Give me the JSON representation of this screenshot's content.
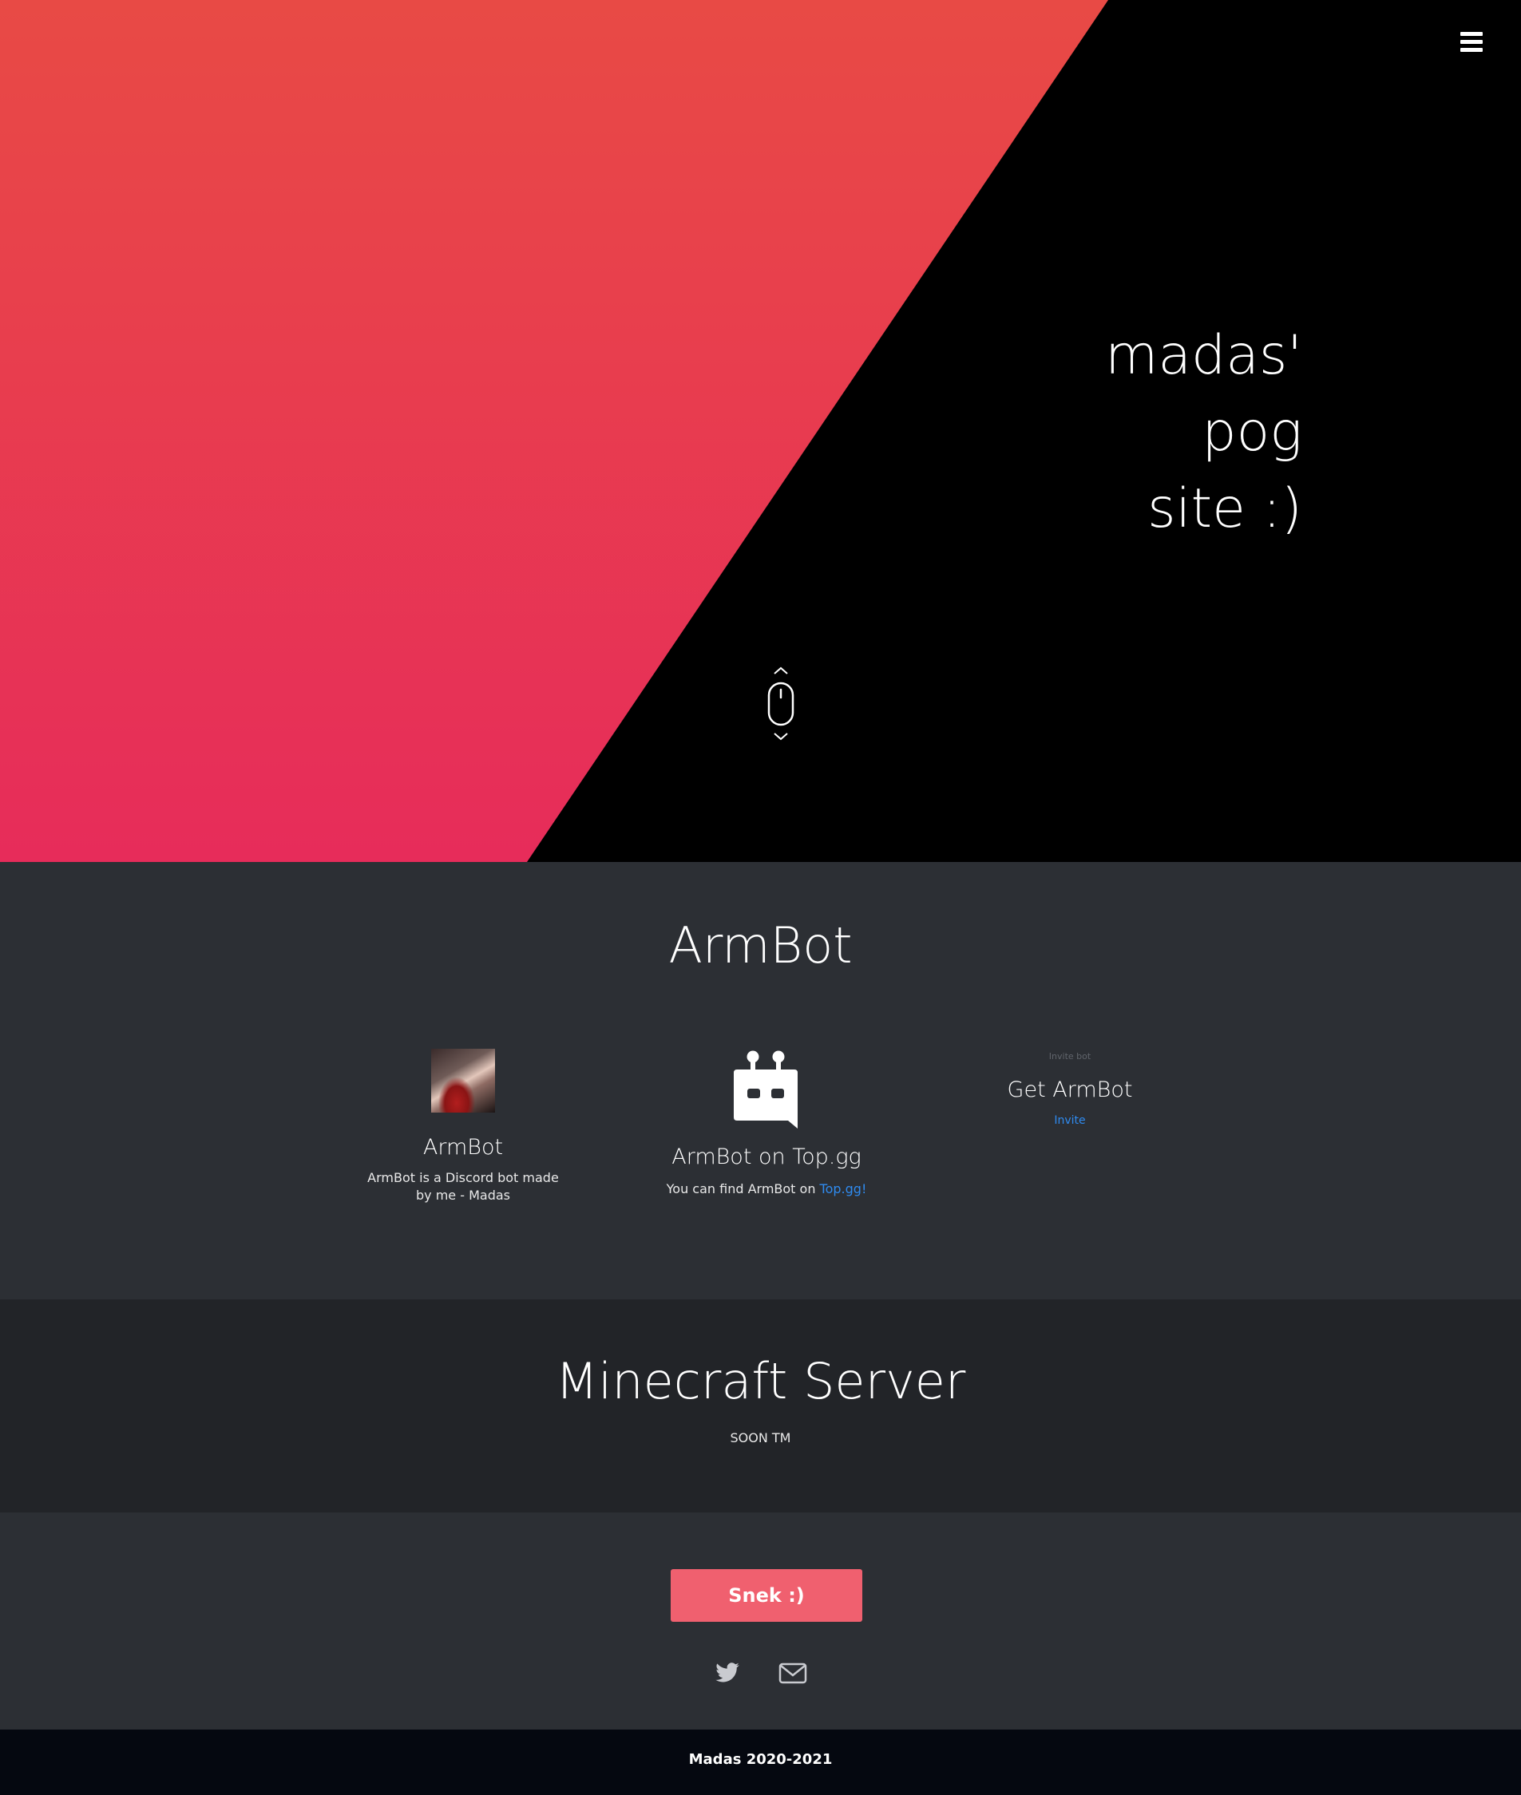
{
  "hero": {
    "title_lines": [
      "madas'",
      "pog",
      "site :)"
    ],
    "colors": {
      "gradient_top": "#e84a45",
      "gradient_bottom": "#e72c5a",
      "dark": "#000000"
    },
    "menu_icon": "hamburger-menu-icon",
    "scroll_icon": "mouse-scroll-icon"
  },
  "armbot": {
    "title": "ArmBot",
    "cards": [
      {
        "title": "ArmBot",
        "text": "ArmBot is a Discord bot made by me - Madas",
        "icon": "armbot-avatar"
      },
      {
        "title": "ArmBot on Top.gg",
        "text_prefix": "You can find ArmBot on ",
        "link_text": "Top.gg!",
        "icon": "topgg-robot-icon"
      },
      {
        "title": "Get ArmBot",
        "image_alt": "Invite bot",
        "link_text": "Invite",
        "icon": "broken-image-icon"
      }
    ]
  },
  "minecraft": {
    "title": "Minecraft Server",
    "text": "SOON TM"
  },
  "cta": {
    "button_label": "Snek :)",
    "button_color": "#f0606f",
    "social_icons": [
      "twitter-icon",
      "mail-icon"
    ]
  },
  "footer": {
    "text": "Madas 2020-2021"
  }
}
